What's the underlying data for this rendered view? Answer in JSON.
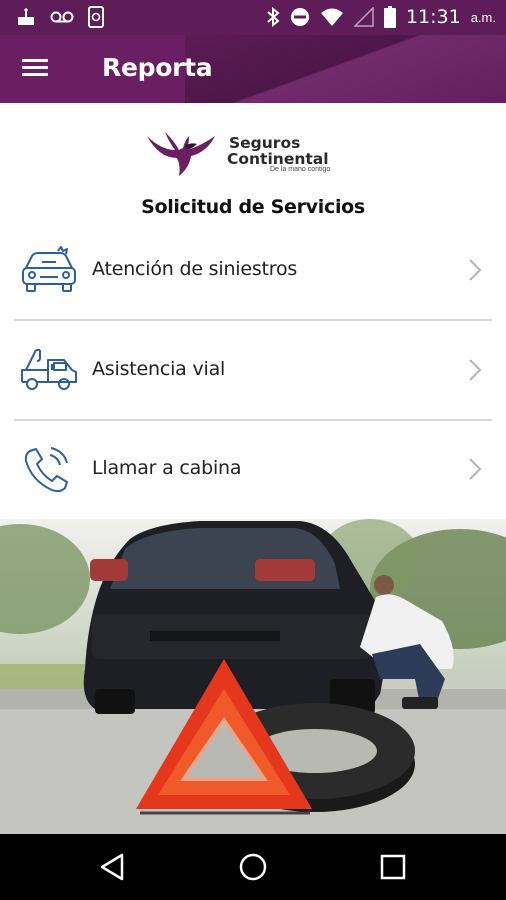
{
  "status_bar": {
    "time": "11:31",
    "ampm": "a.m.",
    "icons": [
      "cake-icon",
      "voicemail-icon",
      "phone-sync-icon",
      "bluetooth-icon",
      "do-not-disturb-icon",
      "wifi-icon",
      "no-signal-icon",
      "battery-icon"
    ]
  },
  "app_bar": {
    "title": "Reporta",
    "menu_icon": "hamburger-menu-icon"
  },
  "logo": {
    "brand_line1": "Seguros",
    "brand_line2": "Continental",
    "tagline": "De la mano contigo"
  },
  "section_title": "Solicitud de Servicios",
  "services": [
    {
      "label": "Atención de siniestros",
      "icon": "car-damage-icon"
    },
    {
      "label": "Asistencia vial",
      "icon": "tow-truck-icon"
    },
    {
      "label": "Llamar a cabina",
      "icon": "phone-call-icon"
    }
  ],
  "colors": {
    "primary": "#6a1f63",
    "status_bar": "#5e1d58",
    "icon_blue": "#2e5f9e",
    "divider": "#d8d8d8"
  },
  "nav_bar": {
    "icons": [
      "back-icon",
      "home-icon",
      "recents-icon"
    ]
  }
}
